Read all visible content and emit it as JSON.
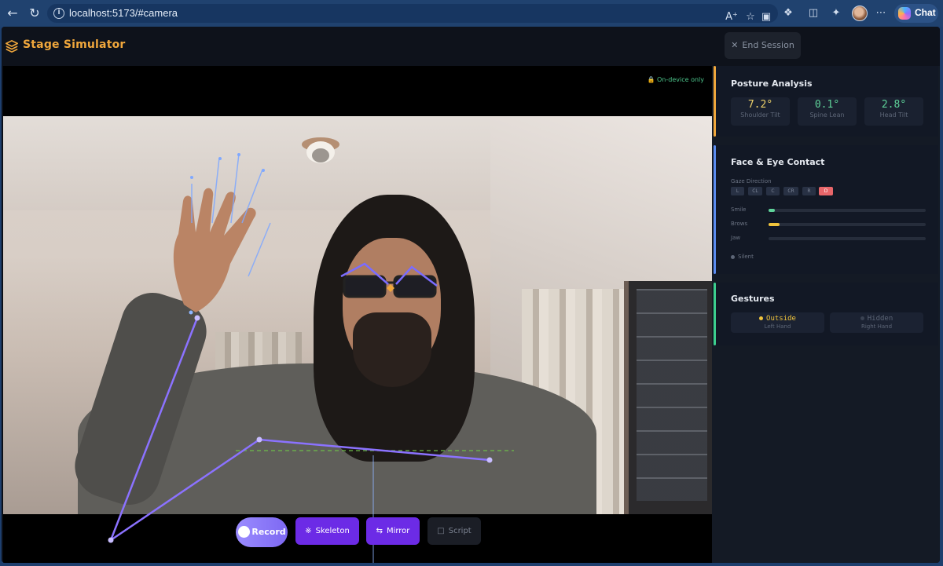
{
  "browser": {
    "url": "localhost:5173/#camera",
    "chat_label": "Chat",
    "icons": [
      "back-icon",
      "reload-icon",
      "info-icon",
      "read-aloud-icon",
      "favorite-icon",
      "video-icon",
      "extensions-icon",
      "split-screen-icon",
      "favorites-icon",
      "more-icon"
    ]
  },
  "app": {
    "title": "Stage Simulator",
    "end_session_label": "End Session",
    "accent": "#f0a73c"
  },
  "video": {
    "privacy_label": "On-device only",
    "controls": {
      "record": "Record",
      "skeleton": "Skeleton",
      "mirror": "Mirror",
      "script": "Script"
    }
  },
  "posture": {
    "title": "Posture Analysis",
    "accent": "#f0a73c",
    "metrics": [
      {
        "value": "7.2°",
        "label": "Shoulder Tilt",
        "color": "#f0d36b"
      },
      {
        "value": "0.1°",
        "label": "Spine Lean",
        "color": "#5fd39a"
      },
      {
        "value": "2.8°",
        "label": "Head Tilt",
        "color": "#5fd39a"
      }
    ]
  },
  "face": {
    "title": "Face & Eye Contact",
    "accent": "#5b8cf0",
    "gaze_label": "Gaze Direction",
    "gaze": [
      "L",
      "CL",
      "C",
      "CR",
      "R",
      "D"
    ],
    "gaze_active": "D",
    "bars": [
      {
        "label": "Smile",
        "level": 0.04,
        "color": "#5fd39a"
      },
      {
        "label": "Brows",
        "level": 0.07,
        "color": "#f0c43c"
      },
      {
        "label": "Jaw",
        "level": 0,
        "color": "#5d6677"
      }
    ],
    "status": "Silent"
  },
  "gestures": {
    "title": "Gestures",
    "accent": "#3ccf8e",
    "items": [
      {
        "state": "Outside",
        "label": "Left Hand",
        "color": "#f0c43c"
      },
      {
        "state": "Hidden",
        "label": "Right Hand",
        "color": "#5d6677"
      }
    ]
  }
}
